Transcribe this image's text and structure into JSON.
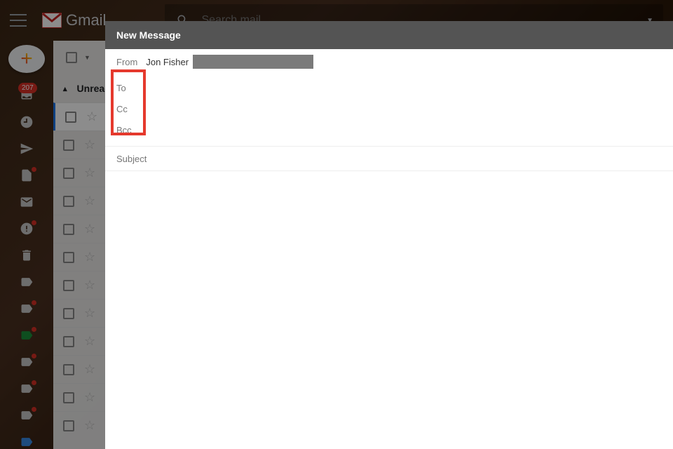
{
  "header": {
    "app_name": "Gmail",
    "search_placeholder": "Search mail"
  },
  "leftrail": {
    "badge_count": "207"
  },
  "list": {
    "unread_label": "Unread"
  },
  "compose": {
    "title": "New Message",
    "from_label": "From",
    "from_name": "Jon Fisher",
    "to_label": "To",
    "cc_label": "Cc",
    "bcc_label": "Bcc",
    "subject_label": "Subject"
  }
}
